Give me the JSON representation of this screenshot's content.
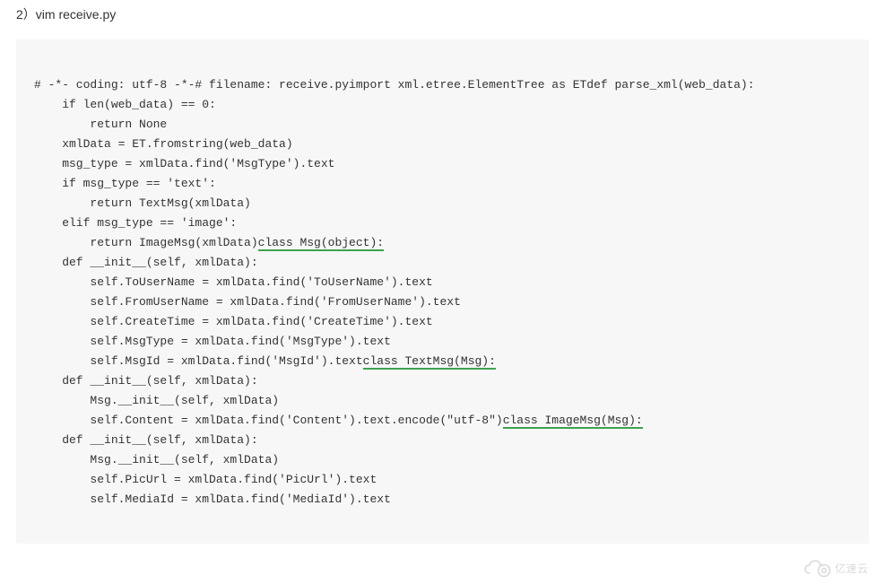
{
  "heading": "2）vim receive.py",
  "code": {
    "l01": "# -*- coding: utf-8 -*-# filename: receive.pyimport xml.etree.ElementTree as ETdef parse_xml(web_data):",
    "l02": "    if len(web_data) == 0:",
    "l03": "        return None",
    "l04": "    xmlData = ET.fromstring(web_data)",
    "l05": "    msg_type = xmlData.find('MsgType').text",
    "l06": "    if msg_type == 'text':",
    "l07": "        return TextMsg(xmlData)",
    "l08": "    elif msg_type == 'image':",
    "l09a": "        return ImageMsg(xmlData)",
    "l09b": "class Msg(object):",
    "l10": "    def __init__(self, xmlData):",
    "l11": "        self.ToUserName = xmlData.find('ToUserName').text",
    "l12": "        self.FromUserName = xmlData.find('FromUserName').text",
    "l13": "        self.CreateTime = xmlData.find('CreateTime').text",
    "l14": "        self.MsgType = xmlData.find('MsgType').text",
    "l15a": "        self.MsgId = xmlData.find('MsgId').text",
    "l15b": "class TextMsg(Msg):",
    "l16": "    def __init__(self, xmlData):",
    "l17": "        Msg.__init__(self, xmlData)",
    "l18a": "        self.Content = xmlData.find('Content').text.encode(\"utf-8\")",
    "l18b": "class ImageMsg(Msg):",
    "l19": "    def __init__(self, xmlData):",
    "l20": "        Msg.__init__(self, xmlData)",
    "l21": "        self.PicUrl = xmlData.find('PicUrl').text",
    "l22": "        self.MediaId = xmlData.find('MediaId').text"
  },
  "watermark": {
    "text": "亿速云"
  }
}
